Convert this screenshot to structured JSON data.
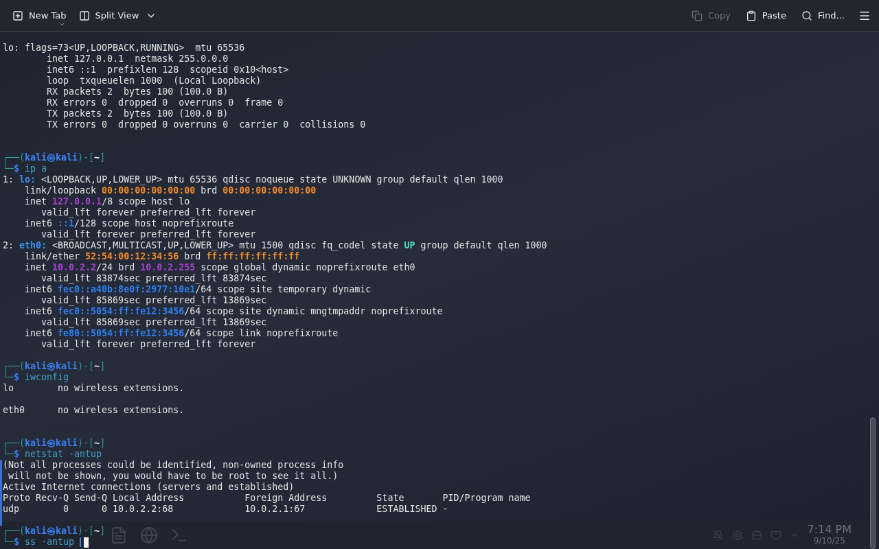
{
  "toolbar": {
    "left": [
      {
        "label": "New Tab",
        "kind": "new-tab"
      },
      {
        "label": "Split View",
        "kind": "split-view"
      }
    ],
    "right": [
      {
        "label": "Copy",
        "kind": "copy",
        "disabled": true
      },
      {
        "label": "Paste",
        "kind": "paste",
        "disabled": false
      },
      {
        "label": "Find...",
        "kind": "find",
        "disabled": false
      }
    ]
  },
  "terminal": {
    "lines": [
      {
        "kind": "text",
        "marked": false,
        "segments": [
          {
            "text": "lo: flags=73<UP,LOOPBACK,RUNNING>  mtu 65536",
            "color": "#e4e4e4"
          }
        ]
      },
      {
        "kind": "text",
        "marked": false,
        "segments": [
          {
            "text": "        inet 127.0.0.1  netmask 255.0.0.0",
            "color": "#e4e4e4"
          }
        ]
      },
      {
        "kind": "text",
        "marked": false,
        "segments": [
          {
            "text": "        inet6 ::1  prefixlen 128  scopeid 0x10<host>",
            "color": "#e4e4e4"
          }
        ]
      },
      {
        "kind": "text",
        "marked": false,
        "segments": [
          {
            "text": "        loop  txqueuelen 1000  (Local Loopback)",
            "color": "#e4e4e4"
          }
        ]
      },
      {
        "kind": "text",
        "marked": false,
        "segments": [
          {
            "text": "        RX packets 2  bytes 100 (100.0 B)",
            "color": "#e4e4e4"
          }
        ]
      },
      {
        "kind": "text",
        "marked": false,
        "segments": [
          {
            "text": "        RX errors 0  dropped 0  overruns 0  frame 0",
            "color": "#e4e4e4"
          }
        ]
      },
      {
        "kind": "text",
        "marked": false,
        "segments": [
          {
            "text": "        TX packets 2  bytes 100 (100.0 B)",
            "color": "#e4e4e4"
          }
        ]
      },
      {
        "kind": "text",
        "marked": false,
        "segments": [
          {
            "text": "        TX errors 0  dropped 0 overruns 0  carrier 0  collisions 0",
            "color": "#e4e4e4"
          }
        ]
      },
      {
        "kind": "blank",
        "marked": false
      },
      {
        "kind": "blank",
        "marked": false
      },
      {
        "kind": "prompt",
        "marked": false,
        "segments": [
          {
            "text": "┌──(",
            "color": "#2f9e8f"
          },
          {
            "text": "kali㉿kali",
            "color": "#3b82f6",
            "bold": true
          },
          {
            "text": ")-[",
            "color": "#2f9e8f"
          },
          {
            "text": "~",
            "color": "#f5f5f5",
            "bold": true
          },
          {
            "text": "]",
            "color": "#2f9e8f"
          }
        ]
      },
      {
        "kind": "prompt",
        "marked": false,
        "segments": [
          {
            "text": "└─",
            "color": "#2f9e8f"
          },
          {
            "text": "$",
            "color": "#3b82f6",
            "bold": true
          },
          {
            "text": " ip a",
            "color": "#45a0c8"
          }
        ]
      },
      {
        "kind": "text",
        "marked": false,
        "segments": [
          {
            "text": "1: ",
            "color": "#e4e4e4"
          },
          {
            "text": "lo:",
            "color": "#3b8eea",
            "bold": true
          },
          {
            "text": " <LOOPBACK,UP,LOWER_UP> mtu 65536 qdisc noqueue state UNKNOWN group default qlen 1000",
            "color": "#e4e4e4"
          }
        ]
      },
      {
        "kind": "text",
        "marked": false,
        "segments": [
          {
            "text": "    link/loopback ",
            "color": "#e4e4e4"
          },
          {
            "text": "00:00:00:00:00:00",
            "color": "#f0892b",
            "bold": true
          },
          {
            "text": " brd ",
            "color": "#e4e4e4"
          },
          {
            "text": "00:00:00:00:00:00",
            "color": "#f0892b",
            "bold": true
          }
        ]
      },
      {
        "kind": "text",
        "marked": false,
        "segments": [
          {
            "text": "    inet ",
            "color": "#e4e4e4"
          },
          {
            "text": "127.0.0.1",
            "color": "#a83fd0",
            "bold": true
          },
          {
            "text": "/8 scope host lo",
            "color": "#e4e4e4"
          }
        ]
      },
      {
        "kind": "text",
        "marked": false,
        "segments": [
          {
            "text": "       valid_lft forever preferred_lft forever",
            "color": "#e4e4e4"
          }
        ]
      },
      {
        "kind": "text",
        "marked": false,
        "segments": [
          {
            "text": "    inet6 ",
            "color": "#e4e4e4"
          },
          {
            "text": "::1",
            "color": "#2f7ff0",
            "bold": true
          },
          {
            "text": "/128 scope host noprefixroute",
            "color": "#e4e4e4"
          }
        ]
      },
      {
        "kind": "text",
        "marked": false,
        "segments": [
          {
            "text": "       valid_lft forever preferred_lft forever",
            "color": "#e4e4e4"
          }
        ]
      },
      {
        "kind": "text",
        "marked": false,
        "segments": [
          {
            "text": "2: ",
            "color": "#e4e4e4"
          },
          {
            "text": "eth0:",
            "color": "#3b8eea",
            "bold": true
          },
          {
            "text": " <BROADCAST,MULTICAST,UP,LOWER_UP> mtu 1500 qdisc fq_codel state ",
            "color": "#e4e4e4"
          },
          {
            "text": "UP",
            "color": "#4fd6b8",
            "bold": true
          },
          {
            "text": " group default qlen 1000",
            "color": "#e4e4e4"
          }
        ]
      },
      {
        "kind": "text",
        "marked": false,
        "segments": [
          {
            "text": "    link/ether ",
            "color": "#e4e4e4"
          },
          {
            "text": "52:54:00:12:34:56",
            "color": "#f0892b",
            "bold": true
          },
          {
            "text": " brd ",
            "color": "#e4e4e4"
          },
          {
            "text": "ff:ff:ff:ff:ff:ff",
            "color": "#f0892b",
            "bold": true
          }
        ]
      },
      {
        "kind": "text",
        "marked": false,
        "segments": [
          {
            "text": "    inet ",
            "color": "#e4e4e4"
          },
          {
            "text": "10.0.2.2",
            "color": "#a83fd0",
            "bold": true
          },
          {
            "text": "/24 brd ",
            "color": "#e4e4e4"
          },
          {
            "text": "10.0.2.255",
            "color": "#a83fd0",
            "bold": true
          },
          {
            "text": " scope global dynamic noprefixroute eth0",
            "color": "#e4e4e4"
          }
        ]
      },
      {
        "kind": "text",
        "marked": false,
        "segments": [
          {
            "text": "       valid_lft 83874sec preferred_lft 83874sec",
            "color": "#e4e4e4"
          }
        ]
      },
      {
        "kind": "text",
        "marked": false,
        "segments": [
          {
            "text": "    inet6 ",
            "color": "#e4e4e4"
          },
          {
            "text": "fec0::a40b:8e0f:2977:10e1",
            "color": "#2f7ff0",
            "bold": true
          },
          {
            "text": "/64 scope site temporary dynamic",
            "color": "#e4e4e4"
          }
        ]
      },
      {
        "kind": "text",
        "marked": false,
        "segments": [
          {
            "text": "       valid_lft 85869sec preferred_lft 13869sec",
            "color": "#e4e4e4"
          }
        ]
      },
      {
        "kind": "text",
        "marked": false,
        "segments": [
          {
            "text": "    inet6 ",
            "color": "#e4e4e4"
          },
          {
            "text": "fec0::5054:ff:fe12:3456",
            "color": "#2f7ff0",
            "bold": true
          },
          {
            "text": "/64 scope site dynamic mngtmpaddr noprefixroute",
            "color": "#e4e4e4"
          }
        ]
      },
      {
        "kind": "text",
        "marked": false,
        "segments": [
          {
            "text": "       valid_lft 85869sec preferred_lft 13869sec",
            "color": "#e4e4e4"
          }
        ]
      },
      {
        "kind": "text",
        "marked": false,
        "segments": [
          {
            "text": "    inet6 ",
            "color": "#e4e4e4"
          },
          {
            "text": "fe80::5054:ff:fe12:3456",
            "color": "#2f7ff0",
            "bold": true
          },
          {
            "text": "/64 scope link noprefixroute",
            "color": "#e4e4e4"
          }
        ]
      },
      {
        "kind": "text",
        "marked": false,
        "segments": [
          {
            "text": "       valid_lft forever preferred_lft forever",
            "color": "#e4e4e4"
          }
        ]
      },
      {
        "kind": "blank",
        "marked": false
      },
      {
        "kind": "prompt",
        "marked": false,
        "segments": [
          {
            "text": "┌──(",
            "color": "#2f9e8f"
          },
          {
            "text": "kali㉿kali",
            "color": "#3b82f6",
            "bold": true
          },
          {
            "text": ")-[",
            "color": "#2f9e8f"
          },
          {
            "text": "~",
            "color": "#f5f5f5",
            "bold": true
          },
          {
            "text": "]",
            "color": "#2f9e8f"
          }
        ]
      },
      {
        "kind": "prompt",
        "marked": false,
        "segments": [
          {
            "text": "└─",
            "color": "#2f9e8f"
          },
          {
            "text": "$",
            "color": "#3b82f6",
            "bold": true
          },
          {
            "text": " iwconfig",
            "color": "#45a0c8"
          }
        ]
      },
      {
        "kind": "text",
        "marked": false,
        "segments": [
          {
            "text": "lo        no wireless extensions.",
            "color": "#e4e4e4"
          }
        ]
      },
      {
        "kind": "blank",
        "marked": false
      },
      {
        "kind": "text",
        "marked": false,
        "segments": [
          {
            "text": "eth0      no wireless extensions.",
            "color": "#e4e4e4"
          }
        ]
      },
      {
        "kind": "blank",
        "marked": false
      },
      {
        "kind": "blank",
        "marked": false
      },
      {
        "kind": "prompt",
        "marked": false,
        "segments": [
          {
            "text": "┌──(",
            "color": "#2f9e8f"
          },
          {
            "text": "kali㉿kali",
            "color": "#3b82f6",
            "bold": true
          },
          {
            "text": ")-[",
            "color": "#2f9e8f"
          },
          {
            "text": "~",
            "color": "#f5f5f5",
            "bold": true
          },
          {
            "text": "]",
            "color": "#2f9e8f"
          }
        ]
      },
      {
        "kind": "prompt",
        "marked": false,
        "segments": [
          {
            "text": "└─",
            "color": "#2f9e8f"
          },
          {
            "text": "$",
            "color": "#3b82f6",
            "bold": true
          },
          {
            "text": " netstat -antup",
            "color": "#45a0c8"
          }
        ]
      },
      {
        "kind": "text",
        "marked": true,
        "segments": [
          {
            "text": "(Not all processes could be identified, non-owned process info",
            "color": "#e4e4e4"
          }
        ]
      },
      {
        "kind": "text",
        "marked": true,
        "segments": [
          {
            "text": " will not be shown, you would have to be root to see it all.)",
            "color": "#e4e4e4"
          }
        ]
      },
      {
        "kind": "text",
        "marked": true,
        "segments": [
          {
            "text": "Active Internet connections (servers and established)",
            "color": "#e4e4e4"
          }
        ]
      },
      {
        "kind": "text",
        "marked": true,
        "segments": [
          {
            "text": "Proto Recv-Q Send-Q Local Address           Foreign Address         State       PID/Program name",
            "color": "#e4e4e4"
          }
        ]
      },
      {
        "kind": "text",
        "marked": true,
        "segments": [
          {
            "text": "udp        0      0 10.0.2.2:68             10.0.2.1:67             ESTABLISHED -",
            "color": "#e4e4e4"
          }
        ]
      },
      {
        "kind": "blank",
        "marked": true
      },
      {
        "kind": "prompt",
        "marked": false,
        "segments": [
          {
            "text": "┌──(",
            "color": "#2f9e8f"
          },
          {
            "text": "kali㉿kali",
            "color": "#3b82f6",
            "bold": true
          },
          {
            "text": ")-[",
            "color": "#2f9e8f"
          },
          {
            "text": "~",
            "color": "#f5f5f5",
            "bold": true
          },
          {
            "text": "]",
            "color": "#2f9e8f"
          }
        ]
      },
      {
        "kind": "input",
        "marked": false,
        "segments": [
          {
            "text": "└─",
            "color": "#2f9e8f"
          },
          {
            "text": "$",
            "color": "#3b82f6",
            "bold": true
          },
          {
            "text": " ss -antup ",
            "color": "#45a0c8"
          }
        ]
      }
    ]
  },
  "taskbar": {
    "clock_time": "7:14 PM",
    "clock_date": "9/10/25"
  }
}
